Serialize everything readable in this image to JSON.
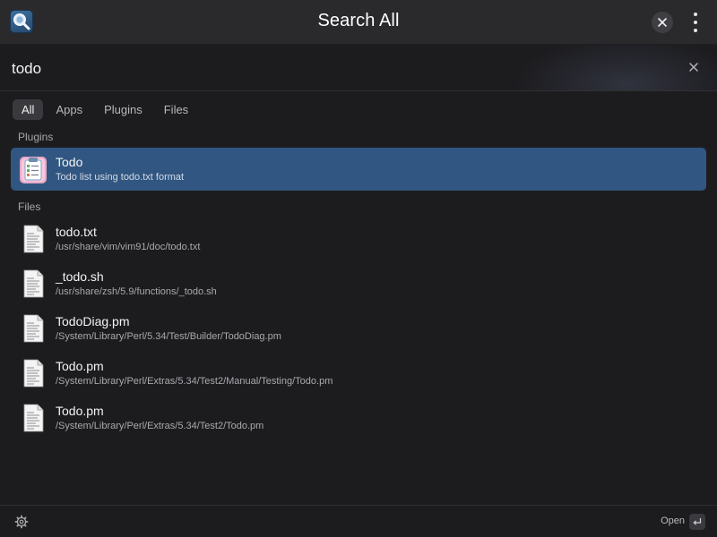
{
  "header": {
    "title": "Search All",
    "app_icon": "magnifier-app-icon",
    "close_icon": "close-icon",
    "menu_icon": "vertical-ellipsis-icon"
  },
  "search": {
    "value": "todo",
    "clear_icon": "clear-icon"
  },
  "tabs": [
    {
      "label": "All",
      "active": true
    },
    {
      "label": "Apps",
      "active": false
    },
    {
      "label": "Plugins",
      "active": false
    },
    {
      "label": "Files",
      "active": false
    }
  ],
  "sections": {
    "plugins": {
      "label": "Plugins",
      "items": [
        {
          "title": "Todo",
          "subtitle": "Todo list using todo.txt format",
          "icon": "clipboard-icon",
          "selected": true
        }
      ]
    },
    "files": {
      "label": "Files",
      "items": [
        {
          "title": "todo.txt",
          "subtitle": "/usr/share/vim/vim91/doc/todo.txt",
          "icon": "document-icon"
        },
        {
          "title": "_todo.sh",
          "subtitle": "/usr/share/zsh/5.9/functions/_todo.sh",
          "icon": "document-icon"
        },
        {
          "title": "TodoDiag.pm",
          "subtitle": "/System/Library/Perl/5.34/Test/Builder/TodoDiag.pm",
          "icon": "document-icon"
        },
        {
          "title": "Todo.pm",
          "subtitle": "/System/Library/Perl/Extras/5.34/Test2/Manual/Testing/Todo.pm",
          "icon": "document-icon"
        },
        {
          "title": "Todo.pm",
          "subtitle": "/System/Library/Perl/Extras/5.34/Test2/Todo.pm",
          "icon": "document-icon"
        }
      ]
    }
  },
  "footer": {
    "open_label": "Open",
    "settings_icon": "gear-icon",
    "enter_icon": "return-key-icon"
  },
  "colors": {
    "background": "#1c1c1f",
    "header": "#2a2a2d",
    "selection": "#315681",
    "tab_active": "#3a3a3e"
  }
}
